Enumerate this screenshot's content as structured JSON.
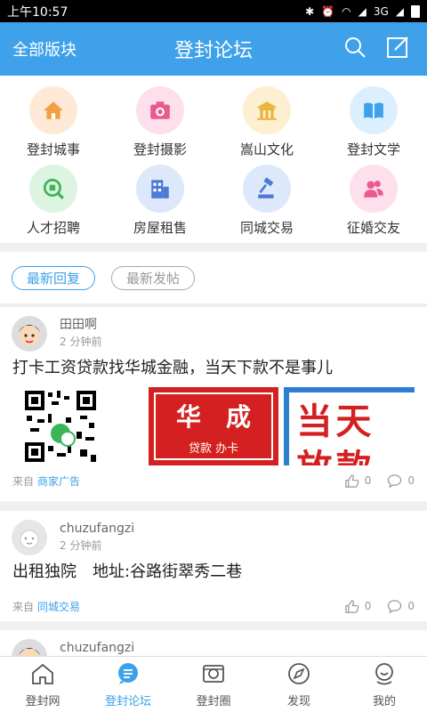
{
  "status": {
    "time": "上午10:57",
    "net": "3G"
  },
  "appbar": {
    "left": "全部版块",
    "title": "登封论坛"
  },
  "categories": [
    {
      "label": "登封城事",
      "icon": "house-icon",
      "bg": "#fde9d6",
      "fg": "#f0a040"
    },
    {
      "label": "登封摄影",
      "icon": "camera-icon",
      "bg": "#fde0ec",
      "fg": "#ea5a8c"
    },
    {
      "label": "嵩山文化",
      "icon": "temple-icon",
      "bg": "#fdf0d0",
      "fg": "#e9b63c"
    },
    {
      "label": "登封文学",
      "icon": "book-icon",
      "bg": "#dcefff",
      "fg": "#3ea1ea"
    },
    {
      "label": "人才招聘",
      "icon": "job-icon",
      "bg": "#ddf4e1",
      "fg": "#3cb55a"
    },
    {
      "label": "房屋租售",
      "icon": "building-icon",
      "bg": "#dde8fb",
      "fg": "#4d7ad6"
    },
    {
      "label": "同城交易",
      "icon": "gavel-icon",
      "bg": "#dde8fb",
      "fg": "#4d7ad6"
    },
    {
      "label": "征婚交友",
      "icon": "people-icon",
      "bg": "#fde0ec",
      "fg": "#ea5a8c"
    }
  ],
  "tabs": {
    "latest_reply": "最新回复",
    "latest_post": "最新发帖"
  },
  "posts": [
    {
      "user": "田田啊",
      "time": "2 分钟前",
      "text": "打卡工资贷款找华城金融，当天下款不是事儿",
      "from_prefix": "来自",
      "from": "商家广告",
      "likes": "0",
      "comments": "0",
      "ad1_big": "华　成",
      "ad1_small": "贷款 办卡",
      "ad2": "当天",
      "ad2b": "放款"
    },
    {
      "user": "chuzufangzi",
      "time": "2 分钟前",
      "text": "出租独院　地址:谷路街翠秀二巷",
      "from_prefix": "来自",
      "from": "同城交易",
      "likes": "0",
      "comments": "0"
    },
    {
      "user": "chuzufangzi"
    }
  ],
  "bottom": [
    {
      "label": "登封网",
      "icon": "home-icon"
    },
    {
      "label": "登封论坛",
      "icon": "forum-icon"
    },
    {
      "label": "登封圈",
      "icon": "camera-circle-icon"
    },
    {
      "label": "发现",
      "icon": "compass-icon"
    },
    {
      "label": "我的",
      "icon": "profile-icon"
    }
  ],
  "colors": {
    "accent": "#3ea1ea"
  }
}
